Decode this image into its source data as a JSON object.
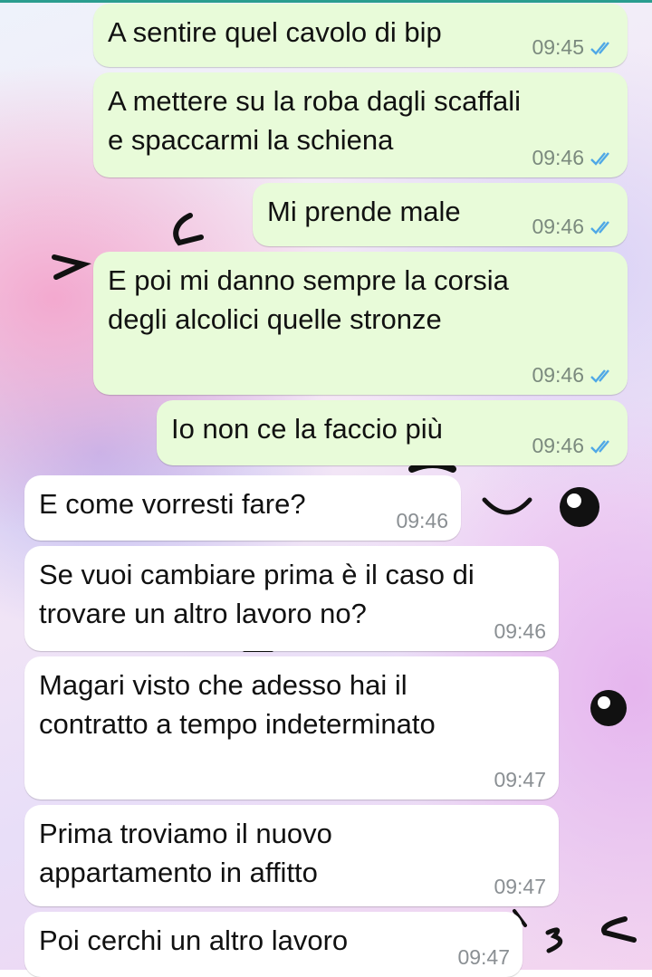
{
  "theme": {
    "outgoing_bubble": "#e8fbd9",
    "incoming_bubble": "#ffffff",
    "read_tick": "#4fa8e6",
    "timestamp": "#7b8a7e"
  },
  "messages": [
    {
      "direction": "outgoing",
      "text": "A sentire quel cavolo di bip",
      "time": "09:45",
      "status": "read"
    },
    {
      "direction": "outgoing",
      "text": "A mettere su la roba dagli scaffali\ne spaccarmi la schiena",
      "time": "09:46",
      "status": "read"
    },
    {
      "direction": "outgoing",
      "text": "Mi prende male",
      "time": "09:46",
      "status": "read"
    },
    {
      "direction": "outgoing",
      "text": "E poi mi danno sempre la corsia\ndegli alcolici quelle stronze",
      "time": "09:46",
      "status": "read"
    },
    {
      "direction": "outgoing",
      "text": "Io non ce la faccio più",
      "time": "09:46",
      "status": "read"
    },
    {
      "direction": "incoming",
      "text": "E come vorresti fare?",
      "time": "09:46"
    },
    {
      "direction": "incoming",
      "text": "Se vuoi cambiare prima è il caso di\ntrovare un altro lavoro no?",
      "time": "09:46"
    },
    {
      "direction": "incoming",
      "text": "Magari visto che adesso hai il\ncontratto a tempo indeterminato",
      "time": "09:47"
    },
    {
      "direction": "incoming",
      "text": "Prima troviamo il nuovo\nappartamento in affitto",
      "time": "09:47"
    },
    {
      "direction": "incoming",
      "text": "Poi cerchi un altro lavoro",
      "time": "09:47"
    }
  ],
  "icons": {
    "read_receipt": "double-check-icon"
  }
}
